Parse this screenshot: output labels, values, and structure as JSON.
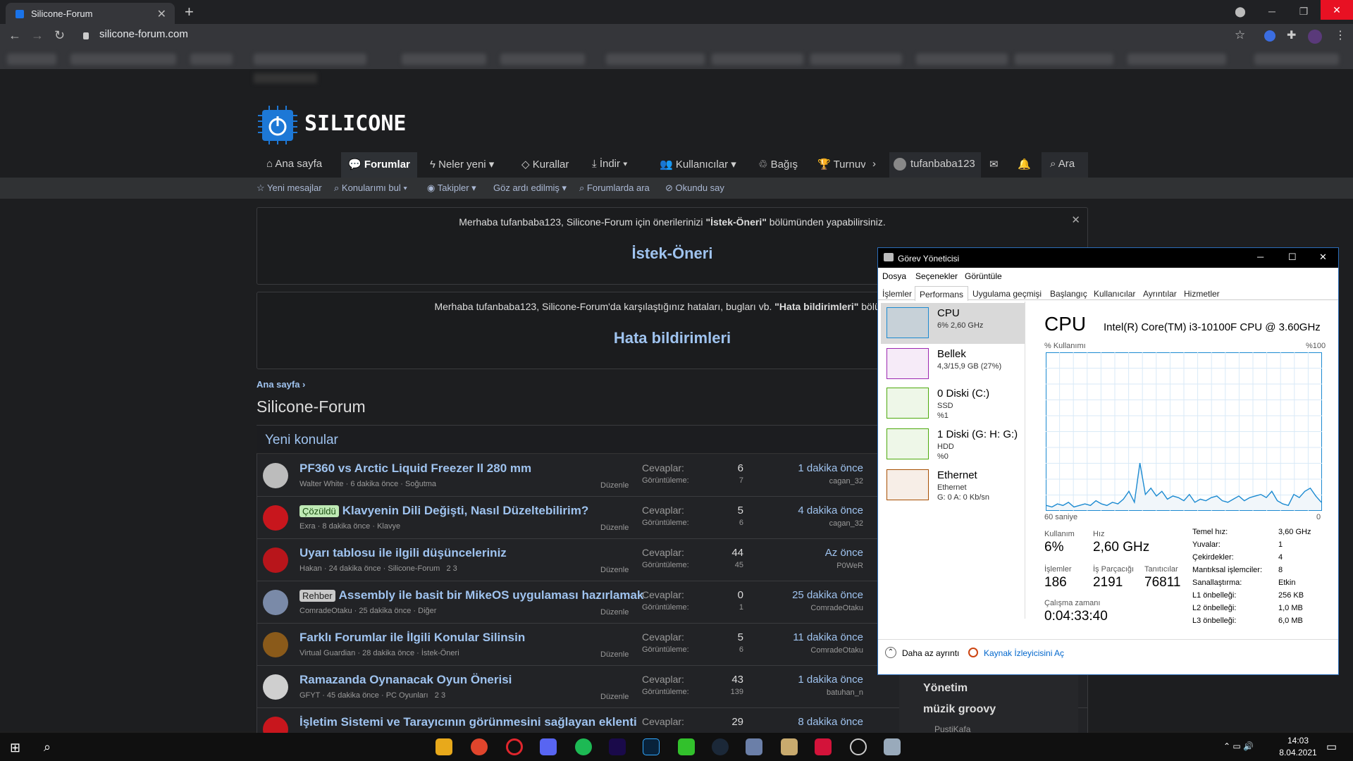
{
  "browser": {
    "tab_title": "Silicone-Forum",
    "new_tab": "+",
    "url": "silicone-forum.com"
  },
  "forum": {
    "logo_text": "SILICONE",
    "nav": [
      "Ana sayfa",
      "Forumlar",
      "Neler yeni",
      "Kurallar",
      "İndir",
      "Kullanıcılar",
      "Bağış",
      "Turnuv",
      "tufanbaba123",
      "Ara"
    ],
    "subnav": [
      "Yeni mesajlar",
      "Konularımı bul",
      "Takipler",
      "Göz ardı edilmiş",
      "Forumlarda ara",
      "Okundu say"
    ],
    "notice1_text_pre": "Merhaba tufanbaba123, Silicone-Forum için önerilerinizi ",
    "notice1_bold": "\"İstek-Öneri\"",
    "notice1_text_post": " bölümünden yapabilirsiniz.",
    "notice1_heading": "İstek-Öneri",
    "notice2_text_pre": "Merhaba tufanbaba123, Silicone-Forum'da karşılaştığınız hataları, bugları vb. ",
    "notice2_bold": "\"Hata bildirimleri\"",
    "notice2_text_post": " bölümünde",
    "notice2_heading": "Hata bildirimleri",
    "breadcrumb": "Ana sayfa",
    "page_title": "Silicone-Forum",
    "block_title": "Yeni konular",
    "edit_label": "Düzenle",
    "replies_label": "Cevaplar:",
    "views_label": "Görüntüleme:",
    "threads": [
      {
        "tag": "",
        "title": "PF360 vs Arctic Liquid Freezer ll 280 mm",
        "author": "Walter White",
        "age": "6 dakika önce",
        "forum": "Soğutma",
        "pages": "",
        "replies": "6",
        "views": "7",
        "last_time": "1 dakika önce",
        "last_user": "cagan_32",
        "avatar_color": "#bcbcbc"
      },
      {
        "tag": "Çözüldü",
        "title": "Klavyenin Dili Değişti, Nasıl Düzeltebilirim?",
        "author": "Exra",
        "age": "8 dakika önce",
        "forum": "Klavye",
        "pages": "",
        "replies": "5",
        "views": "6",
        "last_time": "4 dakika önce",
        "last_user": "cagan_32",
        "avatar_color": "#c8161d"
      },
      {
        "tag": "",
        "title": "Uyarı tablosu ile ilgili düşünceleriniz",
        "author": "Hakan",
        "age": "24 dakika önce",
        "forum": "Silicone-Forum",
        "pages": "2  3",
        "replies": "44",
        "views": "45",
        "last_time": "Az önce",
        "last_user": "P0WeR",
        "avatar_color": "#b8151b"
      },
      {
        "tag": "Rehber",
        "title": "Assembly ile basit bir MikeOS uygulaması hazırlamak",
        "author": "ComradeOtaku",
        "age": "25 dakika önce",
        "forum": "Diğer",
        "pages": "",
        "replies": "0",
        "views": "1",
        "last_time": "25 dakika önce",
        "last_user": "ComradeOtaku",
        "avatar_color": "#7a8aa8"
      },
      {
        "tag": "",
        "title": "Farklı Forumlar ile İlgili Konular Silinsin",
        "author": "Virtual Guardian",
        "age": "28 dakika önce",
        "forum": "İstek-Öneri",
        "pages": "",
        "replies": "5",
        "views": "6",
        "last_time": "11 dakika önce",
        "last_user": "ComradeOtaku",
        "avatar_color": "#8a5a1a"
      },
      {
        "tag": "",
        "title": "Ramazanda Oynanacak Oyun Önerisi",
        "author": "GFYT",
        "age": "45 dakika önce",
        "forum": "PC Oyunları",
        "pages": "2  3",
        "replies": "43",
        "views": "139",
        "last_time": "1 dakika önce",
        "last_user": "batuhan_n",
        "avatar_color": "#cfcfcf"
      },
      {
        "tag": "",
        "title": "İşletim Sistemi ve Tarayıcının görünmesini sağlayan eklenti",
        "author": "",
        "age": "",
        "forum": "",
        "pages": "",
        "replies": "29",
        "views": "",
        "last_time": "8 dakika önce",
        "last_user": "",
        "avatar_color": "#c8161d"
      }
    ],
    "side_items": [
      "Yönetim",
      "müzik groovy",
      "PustiKafa"
    ]
  },
  "taskmgr": {
    "title": "Görev Yöneticisi",
    "menu": [
      "Dosya",
      "Seçenekler",
      "Görüntüle"
    ],
    "tabs": [
      "İşlemler",
      "Performans",
      "Uygulama geçmişi",
      "Başlangıç",
      "Kullanıcılar",
      "Ayrıntılar",
      "Hizmetler"
    ],
    "resources": [
      {
        "name": "CPU",
        "sub1": "6% 2,60 GHz",
        "sub2": "",
        "sub3": "",
        "color": "#1b8ad1"
      },
      {
        "name": "Bellek",
        "sub1": "4,3/15,9 GB (27%)",
        "sub2": "",
        "sub3": "",
        "color": "#9b28b0"
      },
      {
        "name": "0 Diski (C:)",
        "sub1": "SSD",
        "sub2": "%1",
        "sub3": "",
        "color": "#4da90c"
      },
      {
        "name": "1 Diski (G: H: G:)",
        "sub1": "HDD",
        "sub2": "%0",
        "sub3": "",
        "color": "#4da90c"
      },
      {
        "name": "Ethernet",
        "sub1": "Ethernet",
        "sub2": "G: 0 A: 0 Kb/sn",
        "sub3": "",
        "color": "#a74f01"
      }
    ],
    "cpu_heading": "CPU",
    "cpu_model": "Intel(R) Core(TM) i3-10100F CPU @ 3.60GHz",
    "graph_label_left": "% Kullanımı",
    "graph_label_right": "%100",
    "graph_bottom_left": "60 saniye",
    "graph_bottom_right": "0",
    "cpu_usage_series": [
      3,
      2,
      4,
      3,
      5,
      2,
      3,
      4,
      3,
      6,
      4,
      3,
      5,
      4,
      7,
      12,
      5,
      30,
      10,
      14,
      9,
      12,
      7,
      9,
      8,
      6,
      10,
      5,
      7,
      6,
      8,
      9,
      6,
      5,
      7,
      9,
      6,
      8,
      9,
      10,
      8,
      12,
      6,
      4,
      3,
      10,
      8,
      12,
      14,
      9,
      5
    ],
    "stats": {
      "usage_label": "Kullanım",
      "usage": "6%",
      "speed_label": "Hız",
      "speed": "2,60 GHz",
      "proc_label": "İşlemler",
      "proc": "186",
      "threads_label": "İş Parçacığı",
      "threads": "2191",
      "handles_label": "Tanıtıcılar",
      "handles": "76811",
      "uptime_label": "Çalışma zamanı",
      "uptime": "0:04:33:40"
    },
    "specs": [
      [
        "Temel hız:",
        "3,60 GHz"
      ],
      [
        "Yuvalar:",
        "1"
      ],
      [
        "Çekirdekler:",
        "4"
      ],
      [
        "Mantıksal işlemciler:",
        "8"
      ],
      [
        "Sanallaştırma:",
        "Etkin"
      ],
      [
        "L1 önbelleği:",
        "256 KB"
      ],
      [
        "L2 önbelleği:",
        "1,0 MB"
      ],
      [
        "L3 önbelleği:",
        "6,0 MB"
      ]
    ],
    "fewer_details": "Daha az ayrıntı",
    "resource_monitor": "Kaynak İzleyicisini Aç"
  },
  "taskbar": {
    "time": "14:03",
    "date": "8.04.2021"
  }
}
